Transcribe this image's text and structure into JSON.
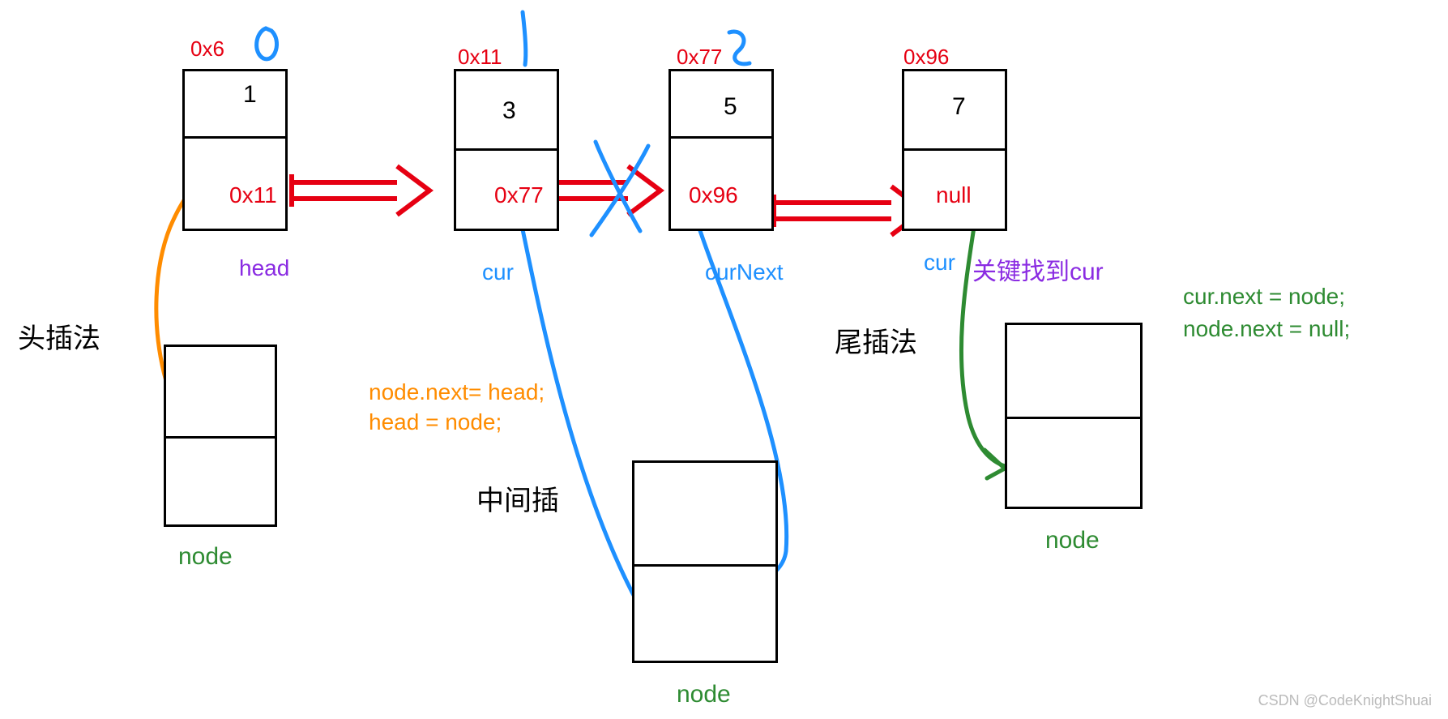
{
  "nodes": {
    "n1": {
      "addr": "0x6",
      "val": "1",
      "next": "0x11",
      "label": "head"
    },
    "n2": {
      "addr": "0x11",
      "val": "3",
      "next": "0x77",
      "label": "cur"
    },
    "n3": {
      "addr": "0x77",
      "val": "5",
      "next": "0x96",
      "label": "curNext"
    },
    "n4": {
      "addr": "0x96",
      "val": "7",
      "next": "null",
      "label": "cur",
      "label2": "关键找到cur"
    }
  },
  "annotations": {
    "handwritten_0": "0",
    "handwritten_1": "1",
    "handwritten_2": "2"
  },
  "insert_head": {
    "title": "头插法",
    "node_label": "node",
    "code1": "node.next= head;",
    "code2": "head = node;"
  },
  "insert_mid": {
    "title": "中间插",
    "node_label": "node"
  },
  "insert_tail": {
    "title": "尾插法",
    "node_label": "node",
    "code1": "cur.next = node;",
    "code2": "node.next = null;"
  },
  "watermark": "CSDN @CodeKnightShuai"
}
